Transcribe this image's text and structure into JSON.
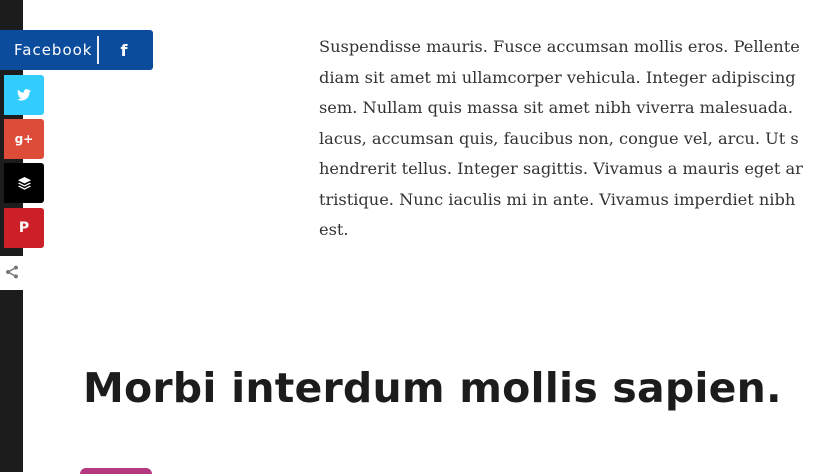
{
  "share": {
    "facebook_label": "Facebook",
    "facebook_icon_glyph": "f",
    "googleplus_icon_glyph": "g+",
    "pinterest_icon_glyph": "P",
    "icons": [
      "facebook-icon",
      "twitter-icon",
      "google-plus-icon",
      "buffer-icon",
      "pinterest-icon",
      "share-icon"
    ],
    "colors": {
      "facebook": "#0b4c9c",
      "twitter": "#33ccff",
      "googleplus": "#dd4b39",
      "buffer": "#000000",
      "pinterest": "#cb2027"
    }
  },
  "article": {
    "paragraph": "Suspendisse mauris. Fusce accumsan mollis eros. Pellente\ndiam sit amet mi ullamcorper vehicula. Integer adipiscing\nsem. Nullam quis massa sit amet nibh viverra malesuada.\nlacus, accumsan quis, faucibus non, congue vel, arcu. Ut s\nhendrerit tellus. Integer sagittis. Vivamus a mauris eget ar\ntristique. Nunc iaculis mi in ante. Vivamus imperdiet nibh\nest.",
    "heading": "Morbi interdum mollis sapien."
  }
}
